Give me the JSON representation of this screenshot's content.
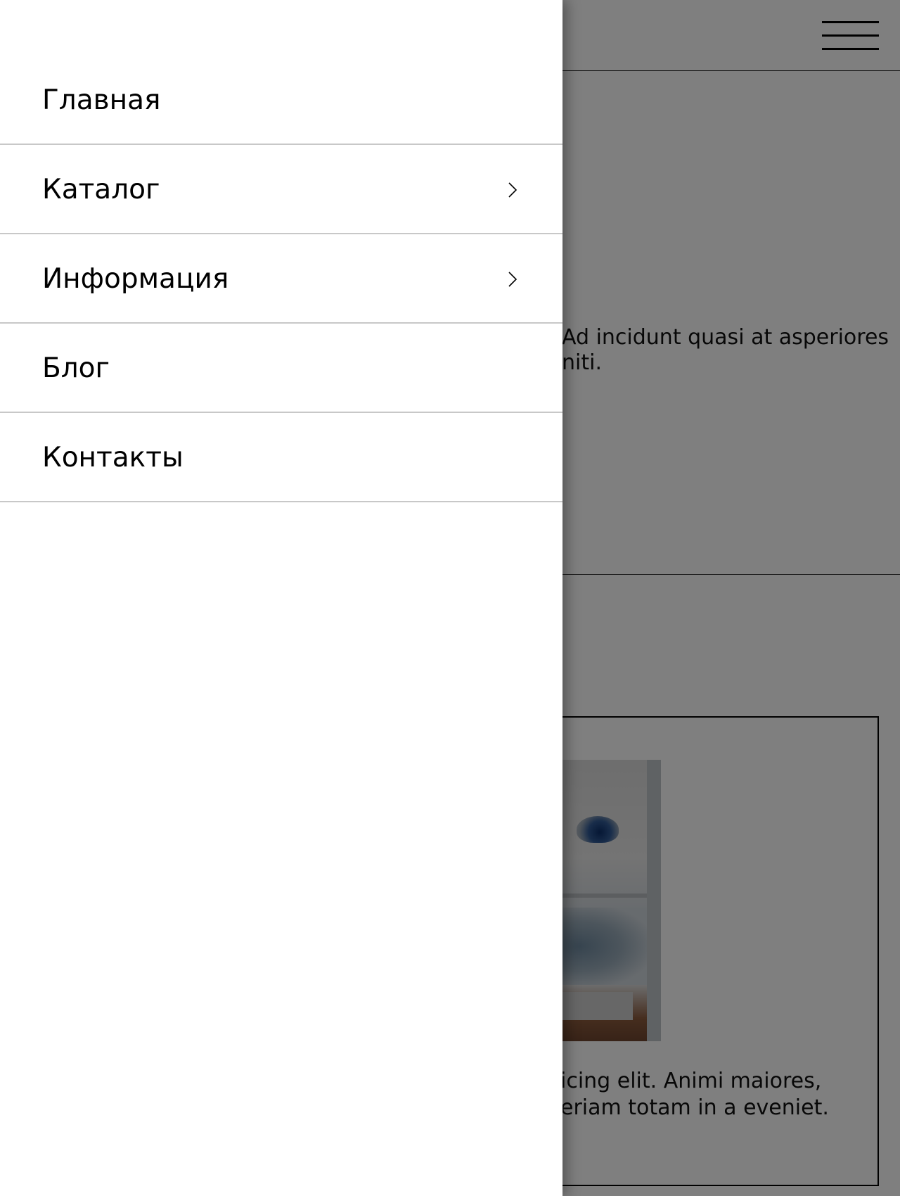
{
  "background": {
    "intro_text_line1": "Ad incidunt quasi at asperiores",
    "intro_text_line2": "niti.",
    "card_text_line1": "icing elit. Animi maiores,",
    "card_text_line2": "eriam totam in a eveniet."
  },
  "header": {
    "menu_button_icon": "hamburger-icon"
  },
  "drawer": {
    "items": [
      {
        "label": "Главная",
        "has_submenu": false
      },
      {
        "label": "Каталог",
        "has_submenu": true
      },
      {
        "label": "Информация",
        "has_submenu": true
      },
      {
        "label": "Блог",
        "has_submenu": false
      },
      {
        "label": "Контакты",
        "has_submenu": false
      }
    ]
  },
  "colors": {
    "overlay": "#000000",
    "text": "#000000",
    "divider": "#c8c8c8"
  }
}
